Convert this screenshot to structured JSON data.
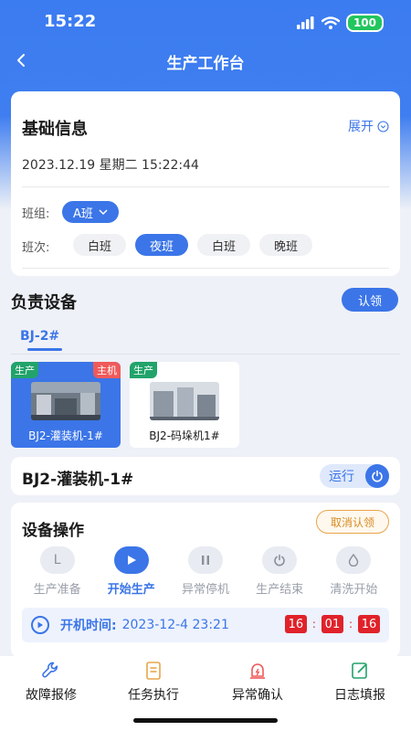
{
  "status_bar": {
    "time": "15:22",
    "battery": "100"
  },
  "header": {
    "title": "生产工作台"
  },
  "basic_info": {
    "title": "基础信息",
    "expand_label": "展开",
    "datetime": "2023.12.19  星期二  15:22:44",
    "team_label": "班组:",
    "team_value": "A班",
    "shift_label": "班次:",
    "shifts": [
      {
        "label": "白班",
        "active": false
      },
      {
        "label": "夜班",
        "active": true
      },
      {
        "label": "白班",
        "active": false
      },
      {
        "label": "晚班",
        "active": false
      }
    ]
  },
  "equipment": {
    "title": "负责设备",
    "claim_button": "认领",
    "tab": "BJ-2#",
    "devices": [
      {
        "name": "BJ2-灌装机-1#",
        "status_badge": "生产",
        "role_badge": "主机",
        "selected": true
      },
      {
        "name": "BJ2-码垛机1#",
        "status_badge": "生产",
        "role_badge": "",
        "selected": false
      }
    ]
  },
  "current_device": {
    "name": "BJ2-灌装机-1#",
    "state": "运行"
  },
  "operations": {
    "title": "设备操作",
    "cancel_claim": "取消认领",
    "steps": [
      {
        "label": "生产准备",
        "icon": "L",
        "active": false
      },
      {
        "label": "开始生产",
        "icon": "play-icon",
        "active": true
      },
      {
        "label": "异常停机",
        "icon": "pause-icon",
        "active": false
      },
      {
        "label": "生产结束",
        "icon": "power-icon",
        "active": false
      },
      {
        "label": "清洗开始",
        "icon": "drop-icon",
        "active": false
      }
    ],
    "start_label": "开机时间:",
    "start_value": "2023-12-4  23:21",
    "timer": {
      "h": "16",
      "m": "01",
      "s": "16"
    }
  },
  "bottom_nav": [
    {
      "label": "故障报修",
      "icon": "wrench-icon"
    },
    {
      "label": "任务执行",
      "icon": "task-list-icon"
    },
    {
      "label": "异常确认",
      "icon": "alert-icon"
    },
    {
      "label": "日志填报",
      "icon": "edit-log-icon"
    }
  ],
  "colors": {
    "primary": "#3b75e8",
    "green": "#22a36b",
    "red": "#e0222a",
    "orange": "#d98a1f"
  }
}
